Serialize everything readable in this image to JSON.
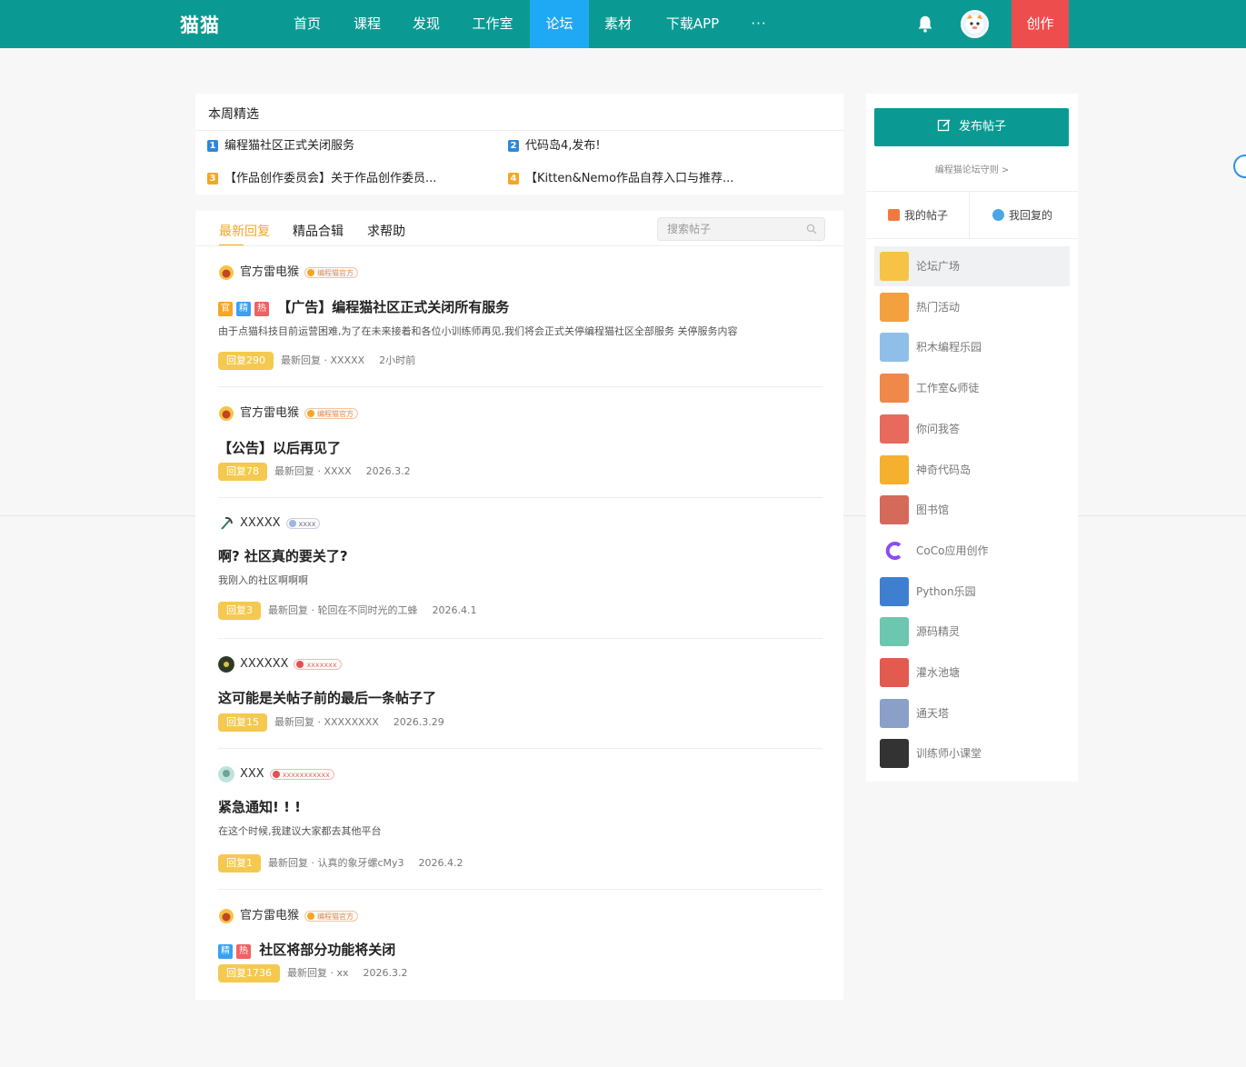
{
  "nav": {
    "logo": "猫猫",
    "items": [
      {
        "label": "首页"
      },
      {
        "label": "课程"
      },
      {
        "label": "发现"
      },
      {
        "label": "工作室"
      },
      {
        "label": "论坛"
      },
      {
        "label": "素材"
      },
      {
        "label": "下载APP"
      },
      {
        "label": "···"
      }
    ],
    "active_item": "论坛",
    "create_label": "创作",
    "colors": {
      "bar": "#0b9a93",
      "active": "#1fa9f4",
      "create": "#ee4d4d"
    }
  },
  "weekly": {
    "title": "本周精选",
    "items": [
      {
        "rank": "1",
        "text": "编程猫社区正式关闭服务"
      },
      {
        "rank": "2",
        "text": "代码岛4,发布!"
      },
      {
        "rank": "3",
        "text": "【作品创作委员会】关于作品创作委员..."
      },
      {
        "rank": "4",
        "text": "【Kitten&Nemo作品自荐入口与推荐..."
      }
    ]
  },
  "forum": {
    "tabs": [
      "最新回复",
      "精品合辑",
      "求帮助"
    ],
    "active_tab": "最新回复",
    "search_placeholder": "搜索帖子",
    "posts": [
      {
        "author": "官方雷电猴",
        "badge": "编程猫官方",
        "tags": [
          "官",
          "精",
          "热"
        ],
        "title": "【广告】编程猫社区正式关闭所有服务",
        "excerpt": "由于点猫科技目前运营困难,为了在未来接着和各位小训练师再见,我们将会正式关停编程猫社区全部服务 关停服务内容",
        "replies": "回复290",
        "last_reply": "最新回复 · XXXXX",
        "time": "2小时前"
      },
      {
        "author": "官方雷电猴",
        "badge": "编程猫官方",
        "tags": [],
        "title": "【公告】以后再见了",
        "excerpt": "",
        "replies": "回复78",
        "last_reply": "最新回复 · XXXX",
        "time": "2026.3.2"
      },
      {
        "author": "XXXXX",
        "badge": "xxxx",
        "badge_num": "0",
        "tags": [],
        "title": "啊? 社区真的要关了?",
        "excerpt": "我刚入的社区啊啊啊",
        "replies": "回复3",
        "last_reply": "最新回复 · 轮回在不同时光的工蜂",
        "time": "2026.4.1"
      },
      {
        "author": "XXXXXX",
        "badge": "xxxxxxx",
        "badge_num": "0",
        "tags": [],
        "title": "这可能是关帖子前的最后一条帖子了",
        "excerpt": "",
        "replies": "回复15",
        "last_reply": "最新回复 · XXXXXXXX",
        "time": "2026.3.29"
      },
      {
        "author": "XXX",
        "badge": "xxxxxxxxxxx",
        "badge_num": "1",
        "tags": [],
        "title": "紧急通知! ! !",
        "excerpt": "在这个时候,我建议大家都去其他平台",
        "replies": "回复1",
        "last_reply": "最新回复 · 认真的象牙螺cMy3",
        "time": "2026.4.2"
      },
      {
        "author": "官方雷电猴",
        "badge": "编程猫官方",
        "tags": [
          "精",
          "热"
        ],
        "title": "社区将部分功能将关闭",
        "excerpt": "",
        "replies": "回复1736",
        "last_reply": "最新回复 · xx",
        "time": "2026.3.2"
      }
    ]
  },
  "sidebar": {
    "publish_label": "发布帖子",
    "rules_link": "编程猫论坛守则 >",
    "my_posts": "我的帖子",
    "my_replies": "我回复的",
    "boards": [
      {
        "label": "论坛广场",
        "icon": "plaza-icon"
      },
      {
        "label": "热门活动",
        "icon": "hot-activity-icon"
      },
      {
        "label": "积木编程乐园",
        "icon": "blocks-icon"
      },
      {
        "label": "工作室&师徒",
        "icon": "studio-icon"
      },
      {
        "label": "你问我答",
        "icon": "qa-icon"
      },
      {
        "label": "神奇代码岛",
        "icon": "code-island-icon"
      },
      {
        "label": "图书馆",
        "icon": "library-icon"
      },
      {
        "label": "CoCo应用创作",
        "icon": "coco-icon"
      },
      {
        "label": "Python乐园",
        "icon": "python-icon"
      },
      {
        "label": "源码精灵",
        "icon": "source-sprite-icon"
      },
      {
        "label": "灌水池塘",
        "icon": "pond-icon"
      },
      {
        "label": "通天塔",
        "icon": "tower-icon"
      },
      {
        "label": "训练师小课堂",
        "icon": "class-icon"
      }
    ],
    "active_board": "论坛广场"
  }
}
